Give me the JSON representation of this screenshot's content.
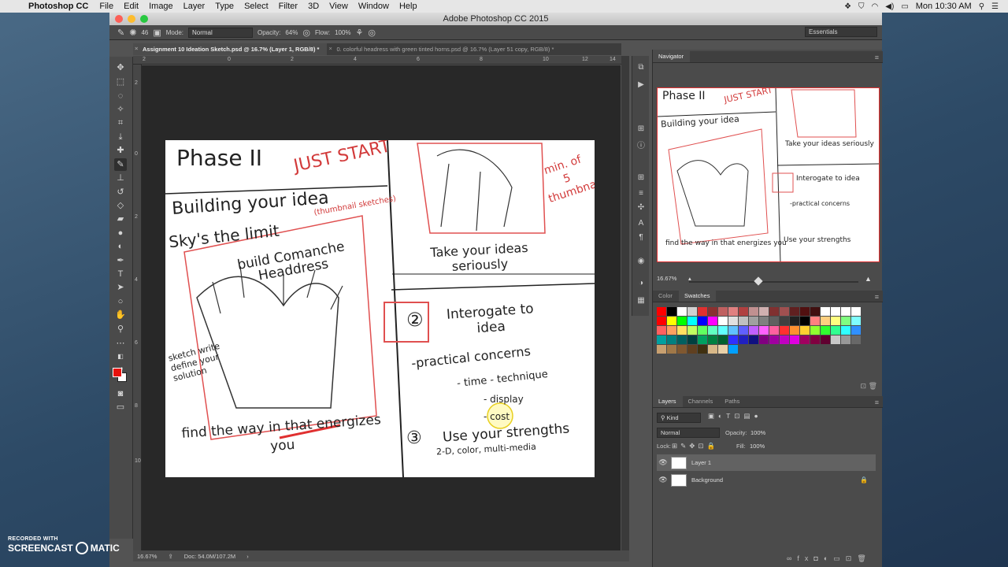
{
  "mac_menu": {
    "app_name": "Photoshop CC",
    "items": [
      "File",
      "Edit",
      "Image",
      "Layer",
      "Type",
      "Select",
      "Filter",
      "3D",
      "View",
      "Window",
      "Help"
    ],
    "clock": "Mon 10:30 AM"
  },
  "window": {
    "title": "Adobe Photoshop CC 2015"
  },
  "options_bar": {
    "brush_size": "46",
    "mode_label": "Mode:",
    "mode_value": "Normal",
    "opacity_label": "Opacity:",
    "opacity_value": "64%",
    "flow_label": "Flow:",
    "flow_value": "100%",
    "workspace": "Essentials"
  },
  "tabs": [
    {
      "label": "Assignment 10 Ideation Sketch.psd @ 16.7% (Layer 1, RGB/8) *",
      "active": true
    },
    {
      "label": "0. colorful headress with green tinted horns.psd @ 16.7% (Layer 51 copy, RGB/8) *",
      "active": false
    }
  ],
  "ruler_top": [
    "2",
    "0",
    "2",
    "4",
    "6",
    "8",
    "10",
    "12",
    "14"
  ],
  "ruler_left": [
    "2",
    "0",
    "2",
    "4",
    "6",
    "8",
    "10"
  ],
  "status": {
    "zoom": "16.67%",
    "doc": "Doc: 54.0M/107.2M"
  },
  "sketch": {
    "phase": "Phase II",
    "just_start": "JUST START",
    "building": "Building your idea",
    "thumbnail_note": "(thumbnail sketches)",
    "step1": "Sky's the limit",
    "build_headdress": "build Comanche Headdress",
    "sketch_side": "sketch write define your solution",
    "find_way": "find the way in that energizes you",
    "min_thumbs": "min. of 5 thumbnails",
    "take_ideas": "Take your ideas seriously",
    "step2": "Interogate to idea",
    "practical": "-practical concerns",
    "time": "- time - technique",
    "display": "- display",
    "cost": "- cost",
    "step3": "Use your strengths",
    "media": "2-D, color, multi-media"
  },
  "navigator": {
    "tab": "Navigator",
    "zoom": "16.67%"
  },
  "swatches": {
    "tabs": [
      "Color",
      "Swatches"
    ],
    "active": "Swatches",
    "colors": [
      "#ff0000",
      "#000000",
      "#ffffff",
      "#d0d0d0",
      "#e03030",
      "#8a3030",
      "#c06060",
      "#e08080",
      "#b04040",
      "#c09090",
      "#d0b0b0",
      "#803030",
      "#a05050",
      "#602020",
      "#501010",
      "#401010",
      "#ffffff",
      "#ffffff",
      "#ffffff",
      "#ffffff",
      "#ff0000",
      "#ffff00",
      "#00ff00",
      "#00ffff",
      "#0000ff",
      "#ff00ff",
      "#ffffff",
      "#e0e0e0",
      "#c0c0c0",
      "#a0a0a0",
      "#808080",
      "#606060",
      "#404040",
      "#202020",
      "#000000",
      "#ff8080",
      "#ffd080",
      "#ffff80",
      "#80ff80",
      "#80ffff",
      "#ff6060",
      "#ffa060",
      "#ffe060",
      "#c0ff60",
      "#60ff60",
      "#60ffc0",
      "#60ffff",
      "#60c0ff",
      "#6060ff",
      "#c060ff",
      "#ff60ff",
      "#ff60a0",
      "#ff3030",
      "#ff9030",
      "#ffd030",
      "#90ff30",
      "#30ff30",
      "#30ff90",
      "#30ffff",
      "#3090ff",
      "#00a0a0",
      "#008080",
      "#006060",
      "#004040",
      "#00a060",
      "#008040",
      "#006030",
      "#3030ff",
      "#2020c0",
      "#101080",
      "#800080",
      "#a000a0",
      "#c000c0",
      "#e000e0",
      "#a00060",
      "#800040",
      "#600030",
      "#c8c8c8",
      "#989898",
      "#686868",
      "#c8a070",
      "#a07848",
      "#805830",
      "#604020",
      "#403010",
      "#d8b888",
      "#e8d0a8",
      "#00a0ff"
    ]
  },
  "layers": {
    "tabs": [
      "Layers",
      "Channels",
      "Paths"
    ],
    "active": "Layers",
    "kind": "Kind",
    "blend": "Normal",
    "opacity_label": "Opacity:",
    "opacity_value": "100%",
    "lock_label": "Lock:",
    "fill_label": "Fill:",
    "fill_value": "100%",
    "rows": [
      {
        "name": "Layer 1",
        "selected": true
      },
      {
        "name": "Background",
        "selected": false
      }
    ]
  },
  "watermark": {
    "line1": "RECORDED WITH",
    "brand_a": "SCREENCAST",
    "brand_b": "MATIC"
  }
}
